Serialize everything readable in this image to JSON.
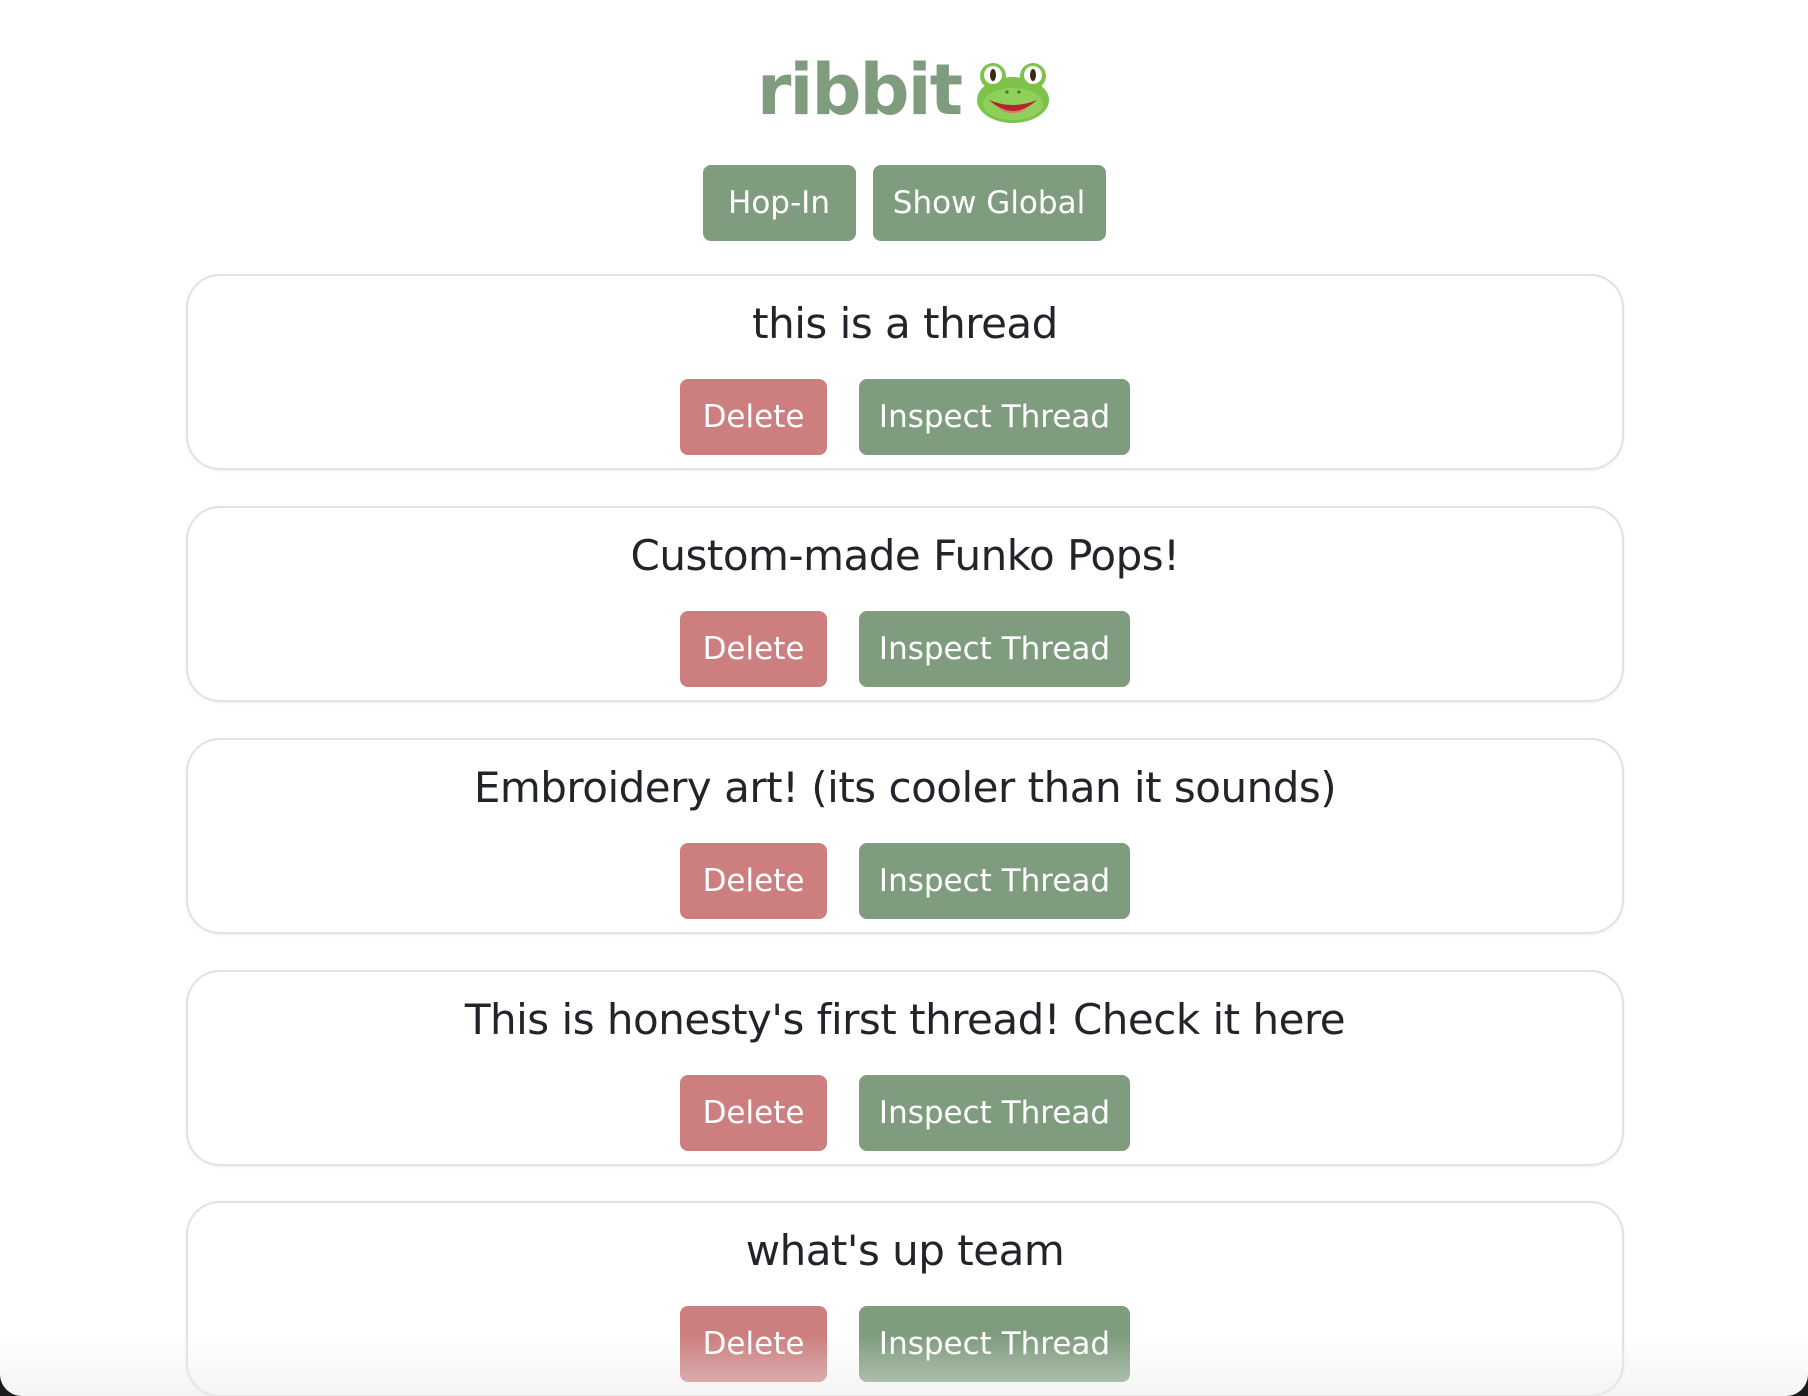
{
  "header": {
    "logo_text": "ribbit",
    "logo_icon": "frog-face-icon"
  },
  "nav": {
    "hop_in_label": "Hop-In",
    "show_global_label": "Show Global"
  },
  "threads": [
    {
      "title": "this is a thread",
      "delete_label": "Delete",
      "inspect_label": "Inspect Thread"
    },
    {
      "title": "Custom-made Funko Pops!",
      "delete_label": "Delete",
      "inspect_label": "Inspect Thread"
    },
    {
      "title": "Embroidery art! (its cooler than it sounds)",
      "delete_label": "Delete",
      "inspect_label": "Inspect Thread"
    },
    {
      "title": "This is honesty's first thread! Check it here",
      "delete_label": "Delete",
      "inspect_label": "Inspect Thread"
    },
    {
      "title": "what's up team",
      "delete_label": "Delete",
      "inspect_label": "Inspect Thread"
    }
  ],
  "colors": {
    "accent_green": "#7f9d7e",
    "delete_red": "#cd7f7f",
    "text_dark": "#212529",
    "card_border": "#e2e2e2"
  }
}
